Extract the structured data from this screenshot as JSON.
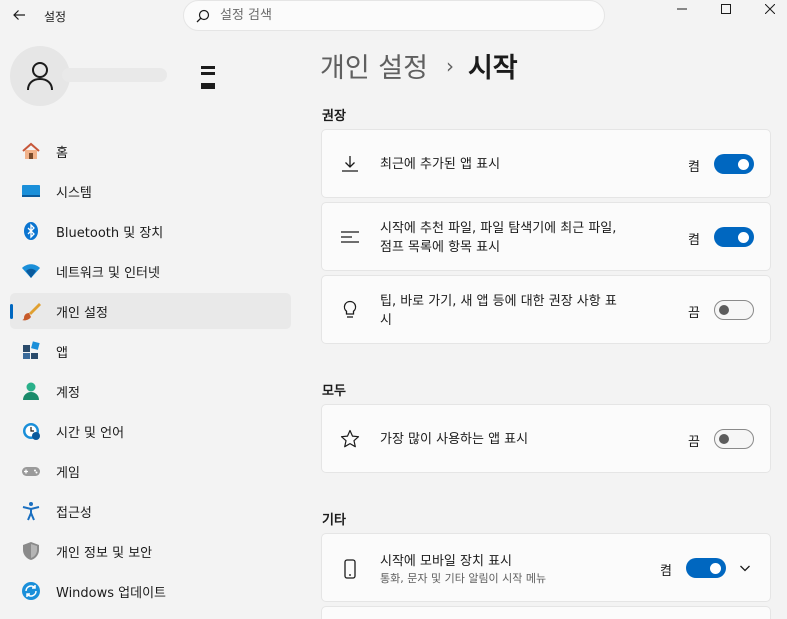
{
  "window": {
    "app_title": "설정",
    "search_placeholder": "설정 검색"
  },
  "sidebar": {
    "items": [
      {
        "label": "홈",
        "icon": "home-icon"
      },
      {
        "label": "시스템",
        "icon": "system-icon"
      },
      {
        "label": "Bluetooth 및 장치",
        "icon": "bluetooth-icon"
      },
      {
        "label": "네트워크 및 인터넷",
        "icon": "wifi-icon"
      },
      {
        "label": "개인 설정",
        "icon": "brush-icon",
        "active": true
      },
      {
        "label": "앱",
        "icon": "apps-icon"
      },
      {
        "label": "계정",
        "icon": "account-icon"
      },
      {
        "label": "시간 및 언어",
        "icon": "time-language-icon"
      },
      {
        "label": "게임",
        "icon": "gamepad-icon"
      },
      {
        "label": "접근성",
        "icon": "accessibility-icon"
      },
      {
        "label": "개인 정보 및 보안",
        "icon": "shield-icon"
      },
      {
        "label": "Windows 업데이트",
        "icon": "update-icon"
      }
    ]
  },
  "breadcrumb": {
    "parent": "개인 설정",
    "separator": "›",
    "current": "시작"
  },
  "sections": {
    "recommended": "권장",
    "all": "모두",
    "other": "기타"
  },
  "settings": {
    "recent_apps": {
      "line1": "최근에 추가된 앱 표시",
      "state": "켬",
      "on": true
    },
    "recommended_files": {
      "line1": "시작에 추천 파일, 파일 탐색기에 최근 파일,",
      "line2": "점프 목록에 항목 표시",
      "state": "켬",
      "on": true
    },
    "tips": {
      "line1": "팁, 바로 가기, 새 앱 등에 대한 권장 사항 표",
      "line2": "시",
      "state": "끔",
      "on": false
    },
    "most_used": {
      "line1": "가장 많이 사용하는 앱 표시",
      "state": "끔",
      "on": false
    },
    "mobile_device": {
      "line1": "시작에 모바일 장치 표시",
      "sub": "통화, 문자 및 기타 알림이 시작 메뉴",
      "state": "켬",
      "on": true
    }
  },
  "colors": {
    "accent": "#0067c0",
    "background": "#f3f3f3",
    "card": "#fbfbfb"
  }
}
